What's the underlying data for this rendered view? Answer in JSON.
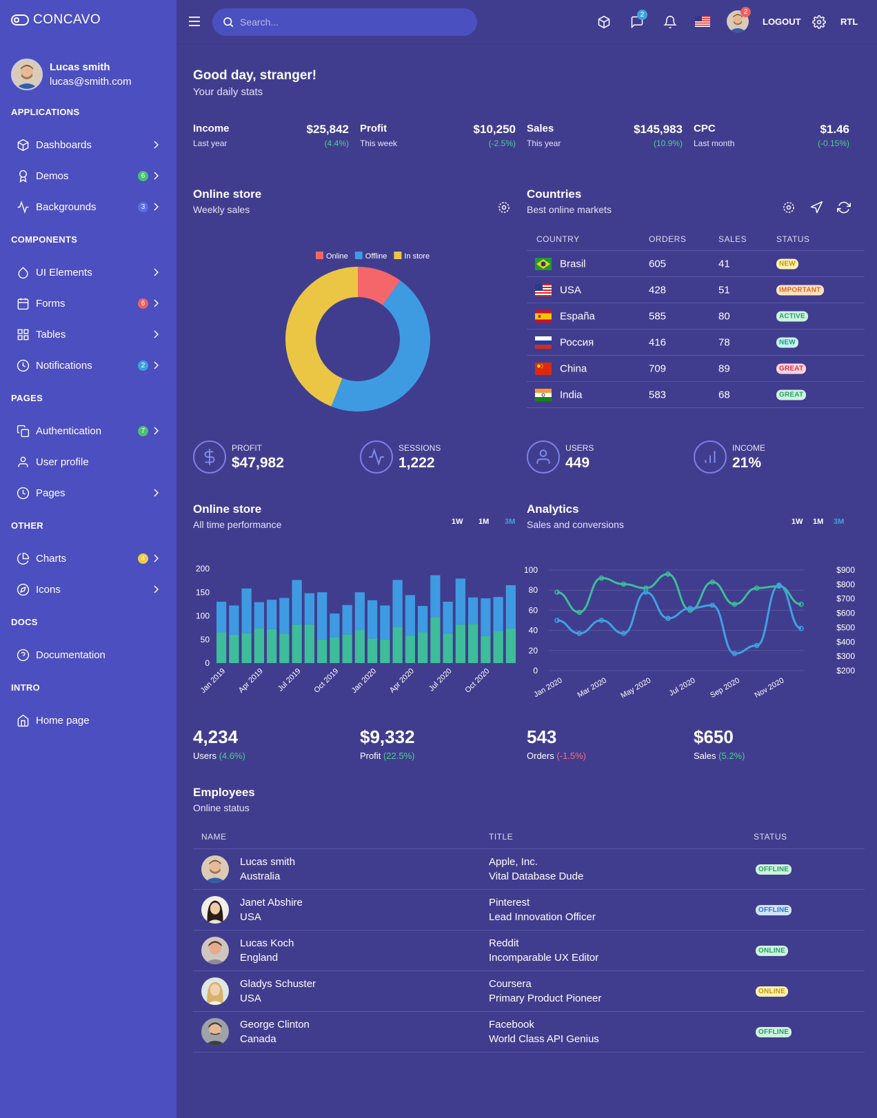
{
  "brand": {
    "name": "CONCAVO"
  },
  "user": {
    "name": "Lucas smith",
    "email": "lucas@smith.com"
  },
  "sidebar": {
    "sections": [
      "APPLICATIONS",
      "COMPONENTS",
      "PAGES",
      "OTHER",
      "DOCS",
      "INTRO"
    ],
    "items": [
      {
        "label": "Dashboards",
        "icon": "cube-icon"
      },
      {
        "label": "Demos",
        "icon": "award-icon",
        "badge": "6",
        "badge_color": "#4bbf73"
      },
      {
        "label": "Backgrounds",
        "icon": "activity-icon",
        "badge": "3",
        "badge_color": "#5b6be8"
      },
      {
        "label": "UI Elements",
        "icon": "droplet-icon"
      },
      {
        "label": "Forms",
        "icon": "calendar-icon",
        "badge": "6",
        "badge_color": "#ee5f60"
      },
      {
        "label": "Tables",
        "icon": "grid-icon"
      },
      {
        "label": "Notifications",
        "icon": "clock-icon",
        "badge": "2",
        "badge_color": "#3ea2e0"
      },
      {
        "label": "Authentication",
        "icon": "copy-icon",
        "badge": "7",
        "badge_color": "#4bbf73"
      },
      {
        "label": "User profile",
        "icon": "user-icon"
      },
      {
        "label": "Pages",
        "icon": "clock-icon"
      },
      {
        "label": "Charts",
        "icon": "pie-chart-icon",
        "badge": "4",
        "badge_color": "#f2c94c"
      },
      {
        "label": "Icons",
        "icon": "compass-icon"
      },
      {
        "label": "Documentation",
        "icon": "help-circle-icon"
      },
      {
        "label": "Home page",
        "icon": "home-icon"
      }
    ]
  },
  "topbar": {
    "search_placeholder": "Search...",
    "messages_badge": "2",
    "avatar_badge": "2",
    "logout": "LOGOUT",
    "rtl": "RTL"
  },
  "greeting": {
    "title": "Good day, stranger!",
    "subtitle": "Your daily stats"
  },
  "stats": [
    {
      "label": "Income",
      "value": "$25,842",
      "period": "Last year",
      "change": "(4.4%)"
    },
    {
      "label": "Profit",
      "value": "$10,250",
      "period": "This week",
      "change": "(-2.5%)"
    },
    {
      "label": "Sales",
      "value": "$145,983",
      "period": "This year",
      "change": "(10.9%)"
    },
    {
      "label": "CPC",
      "value": "$1.46",
      "period": "Last month",
      "change": "(-0.15%)"
    }
  ],
  "online_store": {
    "title": "Online store",
    "subtitle": "Weekly sales"
  },
  "countries": {
    "title": "Countries",
    "subtitle": "Best online markets",
    "headers": [
      "COUNTRY",
      "ORDERS",
      "SALES",
      "STATUS"
    ],
    "rows": [
      {
        "country": "Brasil",
        "orders": "605",
        "sales": "41",
        "status": "NEW",
        "status_bg": "#fdf1b3",
        "status_fg": "#c49a00"
      },
      {
        "country": "USA",
        "orders": "428",
        "sales": "51",
        "status": "IMPORTANT",
        "status_bg": "#fde2c4",
        "status_fg": "#d9691f"
      },
      {
        "country": "España",
        "orders": "585",
        "sales": "80",
        "status": "ACTIVE",
        "status_bg": "#cdf3df",
        "status_fg": "#2f9e63"
      },
      {
        "country": "Россия",
        "orders": "416",
        "sales": "78",
        "status": "NEW",
        "status_bg": "#c8f4ee",
        "status_fg": "#1c9e8c"
      },
      {
        "country": "China",
        "orders": "709",
        "sales": "89",
        "status": "GREAT",
        "status_bg": "#fcd6dc",
        "status_fg": "#d6335b"
      },
      {
        "country": "India",
        "orders": "583",
        "sales": "68",
        "status": "GREAT",
        "status_bg": "#cdf3df",
        "status_fg": "#2f9e63"
      }
    ]
  },
  "kpis": [
    {
      "label": "PROFIT",
      "value": "$47,982",
      "icon": "dollar-icon"
    },
    {
      "label": "SESSIONS",
      "value": "1,222",
      "icon": "activity-icon"
    },
    {
      "label": "USERS",
      "value": "449",
      "icon": "user-icon"
    },
    {
      "label": "INCOME",
      "value": "21%",
      "icon": "bar-chart-icon"
    }
  ],
  "performance": {
    "title": "Online store",
    "subtitle": "All time performance",
    "ranges": [
      "1W",
      "1M",
      "3M"
    ],
    "active_range": "3M"
  },
  "analytics": {
    "title": "Analytics",
    "subtitle": "Sales and conversions",
    "ranges": [
      "1W",
      "1M",
      "3M"
    ],
    "active_range": "3M"
  },
  "summary": [
    {
      "value": "4,234",
      "label": "Users",
      "change": "(4.6%)",
      "color": "#4bd08f"
    },
    {
      "value": "$9,332",
      "label": "Profit",
      "change": "(22.5%)",
      "color": "#4bd08f"
    },
    {
      "value": "543",
      "label": "Orders",
      "change": "(-1.5%)",
      "color": "#ff6b7a"
    },
    {
      "value": "$650",
      "label": "Sales",
      "change": "(5.2%)",
      "color": "#4bd08f"
    }
  ],
  "employees": {
    "title": "Employees",
    "subtitle": "Online status",
    "headers": [
      "NAME",
      "TITLE",
      "STATUS"
    ],
    "rows": [
      {
        "name": "Lucas smith",
        "country": "Australia",
        "company": "Apple, Inc.",
        "role": "Vital Database Dude",
        "status": "OFFLINE",
        "status_bg": "#cdf3df",
        "status_fg": "#2f9e63"
      },
      {
        "name": "Janet Abshire",
        "country": "USA",
        "company": "Pinterest",
        "role": "Lead Innovation Officer",
        "status": "OFFLINE",
        "status_bg": "#cfe4fb",
        "status_fg": "#2d76c8"
      },
      {
        "name": "Lucas Koch",
        "country": "England",
        "company": "Reddit",
        "role": "Incomparable UX Editor",
        "status": "ONLINE",
        "status_bg": "#cdf3df",
        "status_fg": "#2f9e63"
      },
      {
        "name": "Gladys Schuster",
        "country": "USA",
        "company": "Coursera",
        "role": "Primary Product Pioneer",
        "status": "ONLINE",
        "status_bg": "#fdf1b3",
        "status_fg": "#c49a00"
      },
      {
        "name": "George Clinton",
        "country": "Canada",
        "company": "Facebook",
        "role": "World Class API Genius",
        "status": "OFFLINE",
        "status_bg": "#cdf3df",
        "status_fg": "#2f9e63"
      }
    ]
  },
  "colors": {
    "online": "#f5666b",
    "offline": "#3e9be2",
    "instore": "#ebc645",
    "green": "#3dbd9a",
    "blue": "#3ea2e0"
  },
  "chart_data": [
    {
      "type": "pie",
      "legend": [
        "Online",
        "Offline",
        "In store"
      ],
      "values": [
        10,
        46,
        44
      ],
      "legend_position": "top"
    },
    {
      "type": "bar",
      "stacked": true,
      "tick_labels": [
        "Jan 2019",
        "Apr 2019",
        "Jul 2019",
        "Oct 2019",
        "Jan 2020",
        "Apr 2020",
        "Jul 2020",
        "Oct 2020"
      ],
      "series": [
        {
          "values": [
            65,
            60,
            63,
            74,
            72,
            62,
            82,
            82,
            50,
            55,
            61,
            70,
            52,
            50,
            77,
            58,
            65,
            97,
            62,
            82,
            83,
            57,
            68,
            74
          ]
        },
        {
          "values": [
            65,
            62,
            95,
            55,
            62,
            76,
            94,
            66,
            100,
            50,
            62,
            80,
            81,
            72,
            99,
            86,
            56,
            89,
            68,
            97,
            56,
            80,
            72,
            91
          ]
        }
      ],
      "ylim": [
        0,
        200
      ],
      "yticks": [
        0,
        50,
        100,
        150,
        200
      ],
      "grid": false
    },
    {
      "type": "line",
      "tick_labels": [
        "Jan 2020",
        "Mar 2020",
        "May 2020",
        "Jul 2020",
        "Sep 2020",
        "Nov 2020"
      ],
      "series": [
        {
          "values": [
            78,
            58,
            92,
            86,
            82,
            96,
            60,
            88,
            66,
            82,
            84,
            66
          ],
          "axis": "left"
        },
        {
          "values": [
            50,
            37,
            50,
            37,
            78,
            52,
            62,
            65,
            17,
            25,
            85,
            42
          ],
          "axis": "left"
        }
      ],
      "ylim": [
        0,
        100
      ],
      "yticks": [
        0,
        20,
        40,
        60,
        80,
        100
      ],
      "y2ticks": [
        "$200",
        "$300",
        "$400",
        "$500",
        "$600",
        "$700",
        "$800",
        "$900"
      ],
      "grid": true
    }
  ]
}
